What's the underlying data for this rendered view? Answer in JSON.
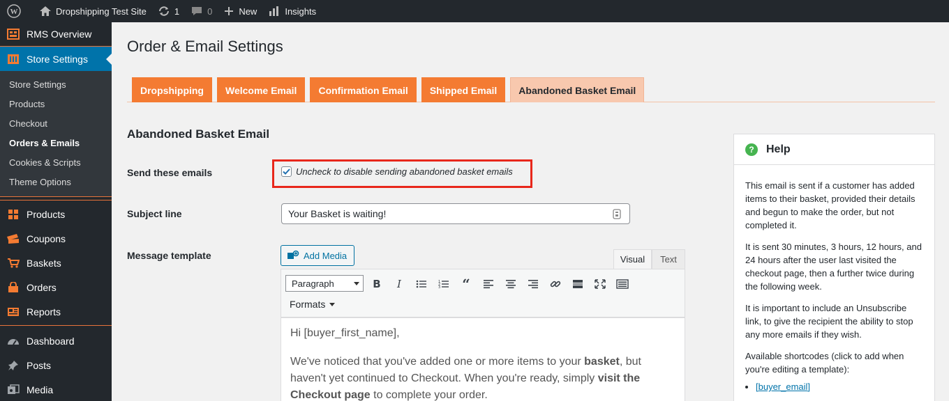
{
  "adminbar": {
    "site_name": "Dropshipping Test Site",
    "updates_count": "1",
    "comments_count": "0",
    "new_label": "New",
    "insights_label": "Insights"
  },
  "sidebar": {
    "top_items": [
      {
        "label": "RMS Overview",
        "icon": "overview-icon"
      },
      {
        "label": "Store Settings",
        "icon": "settings-icon"
      }
    ],
    "submenu": [
      "Store Settings",
      "Products",
      "Checkout",
      "Orders & Emails",
      "Cookies & Scripts",
      "Theme Options"
    ],
    "active_submenu": "Orders & Emails",
    "store_items": [
      {
        "label": "Products",
        "icon": "products-icon"
      },
      {
        "label": "Coupons",
        "icon": "coupons-icon"
      },
      {
        "label": "Baskets",
        "icon": "basket-icon"
      },
      {
        "label": "Orders",
        "icon": "orders-icon"
      },
      {
        "label": "Reports",
        "icon": "reports-icon"
      }
    ],
    "wp_items": [
      {
        "label": "Dashboard",
        "icon": "dashboard-icon"
      },
      {
        "label": "Posts",
        "icon": "pin-icon"
      },
      {
        "label": "Media",
        "icon": "media-icon"
      }
    ]
  },
  "page": {
    "title": "Order & Email Settings",
    "tabs": [
      "Dropshipping",
      "Welcome Email",
      "Confirmation Email",
      "Shipped Email",
      "Abandoned Basket Email"
    ],
    "active_tab": "Abandoned Basket Email",
    "section_title": "Abandoned Basket Email",
    "send_label": "Send these emails",
    "send_checked": true,
    "send_description": "Uncheck to disable sending abandoned basket emails",
    "subject_label": "Subject line",
    "subject_value": "Your Basket is waiting!",
    "message_label": "Message template"
  },
  "editor": {
    "add_media": "Add Media",
    "tab_visual": "Visual",
    "tab_text": "Text",
    "format_select": "Paragraph",
    "formats_label": "Formats",
    "content": {
      "p1": "Hi [buyer_first_name],",
      "p2_a": "We've noticed that you've added one or more items to your ",
      "p2_b": "basket",
      "p2_c": ", but haven't yet continued to Checkout. When you're ready, simply ",
      "p2_d": "visit the Checkout page",
      "p2_e": " to complete your order."
    }
  },
  "help": {
    "title": "Help",
    "p1": "This email is sent if a customer has added items to their basket, provided their details and begun to make the order, but not completed it.",
    "p2": "It is sent 30 minutes, 3 hours, 12 hours, and 24 hours after the user last visited the checkout page, then a further twice during the following week.",
    "p3": "It is important to include an Unsubscribe link, to give the recipient the ability to stop any more emails if they wish.",
    "p4": "Available shortcodes (click to add when you're editing a template):",
    "shortcodes": [
      "[buyer_email]"
    ]
  },
  "colors": {
    "tab_orange": "#f47b32",
    "tab_active": "#f8c8ae",
    "wp_blue": "#0073aa",
    "highlight_red": "#e8271b"
  }
}
